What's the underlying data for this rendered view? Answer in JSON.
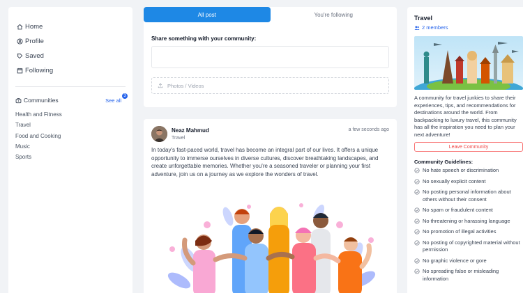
{
  "sidebar": {
    "nav": [
      {
        "label": "Home",
        "icon": "home-icon"
      },
      {
        "label": "Profile",
        "icon": "profile-icon"
      },
      {
        "label": "Saved",
        "icon": "bookmark-icon"
      },
      {
        "label": "Following",
        "icon": "calendar-icon"
      }
    ],
    "communities_title": "Communities",
    "see_all": "See all",
    "see_all_badge": "3",
    "communities": [
      "Health and Fitness",
      "Travel",
      "Food and Cooking",
      "Music",
      "Sports"
    ]
  },
  "feed": {
    "tabs": [
      "All post",
      "You're following"
    ],
    "active_tab": 0,
    "share_label": "Share something with your community:",
    "upload_label": "Photos / Videos"
  },
  "post": {
    "author": "Neaz Mahmud",
    "community": "Travel",
    "time": "a few seconds ago",
    "body": "In today's fast-paced world, travel has become an integral part of our lives. It offers a unique opportunity to immerse ourselves in diverse cultures, discover breathtaking landscapes, and create unforgettable memories. Whether you're a seasoned traveler or planning your first adventure, join us on a journey as we explore the wonders of travel."
  },
  "community": {
    "name": "Travel",
    "members": "2 members",
    "description": "A community for travel junkies to share their experiences, tips, and recommendations for destinations around the world. From backpacking to luxury travel, this community has all the inspiration you need to plan your next adventure!",
    "leave_label": "Leave Community",
    "guidelines_title": "Community Guidelines:",
    "guidelines": [
      "No hate speech or discrimination",
      "No sexually explicit content",
      "No posting personal information about others without their consent",
      "No spam or fraudulent content",
      "No threatening or harassing language",
      "No promotion of illegal activities",
      "No posting of copyrighted material without permission",
      "No graphic violence or gore",
      "No spreading false or misleading information"
    ]
  },
  "colors": {
    "accent": "#1e88e5",
    "link": "#2563eb",
    "danger": "#ef4444"
  }
}
